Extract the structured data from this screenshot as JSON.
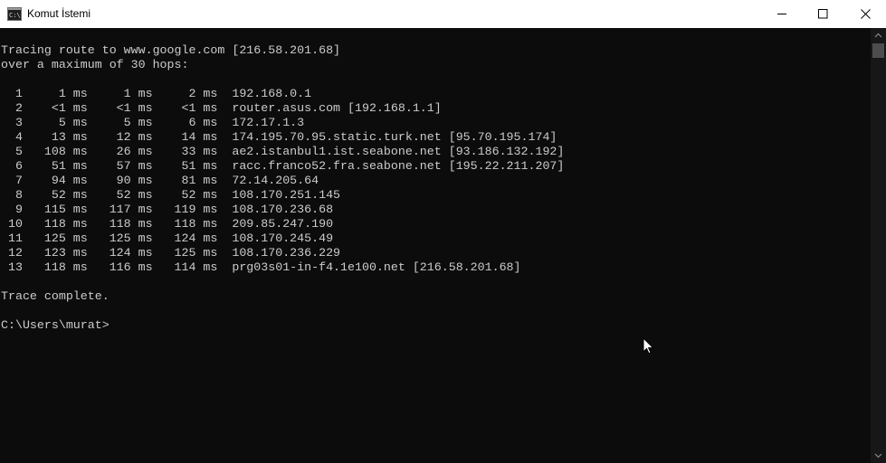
{
  "window": {
    "title": "Komut İstemi",
    "icon": "console-icon",
    "controls": [
      "minimize-icon",
      "maximize-icon",
      "close-icon"
    ]
  },
  "console": {
    "header": [
      "Tracing route to www.google.com [216.58.201.68]",
      "over a maximum of 30 hops:"
    ],
    "hops": [
      "  1     1 ms     1 ms     2 ms  192.168.0.1",
      "  2    <1 ms    <1 ms    <1 ms  router.asus.com [192.168.1.1]",
      "  3     5 ms     5 ms     6 ms  172.17.1.3",
      "  4    13 ms    12 ms    14 ms  174.195.70.95.static.turk.net [95.70.195.174]",
      "  5   108 ms    26 ms    33 ms  ae2.istanbul1.ist.seabone.net [93.186.132.192]",
      "  6    51 ms    57 ms    51 ms  racc.franco52.fra.seabone.net [195.22.211.207]",
      "  7    94 ms    90 ms    81 ms  72.14.205.64",
      "  8    52 ms    52 ms    52 ms  108.170.251.145",
      "  9   115 ms   117 ms   119 ms  108.170.236.68",
      " 10   118 ms   118 ms   118 ms  209.85.247.190",
      " 11   125 ms   125 ms   124 ms  108.170.245.49",
      " 12   123 ms   124 ms   125 ms  108.170.236.229",
      " 13   118 ms   116 ms   114 ms  prg03s01-in-f4.1e100.net [216.58.201.68]"
    ],
    "footer": "Trace complete.",
    "prompt": "C:\\Users\\murat>"
  },
  "colors": {
    "console_background": "#0c0c0c",
    "console_text": "#cccccc",
    "titlebar": "#ffffff"
  }
}
